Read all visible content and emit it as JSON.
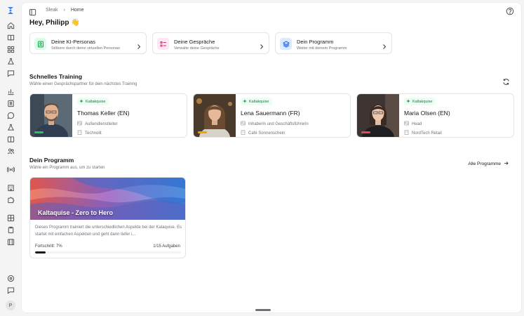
{
  "app": {
    "name": "Sleak"
  },
  "breadcrumb": {
    "root": "Sleak",
    "current": "Home"
  },
  "greeting": "Hey, Philipp 👋",
  "sidebar": {
    "avatar_initial": "P"
  },
  "quick_links": [
    {
      "title": "Deine KI-Personas",
      "subtitle": "Stöbere durch deine virtuellen Personas",
      "icon": "persona-icon",
      "color": "#16a34a",
      "bg": "#dcfce7"
    },
    {
      "title": "Deine Gespräche",
      "subtitle": "Verwalte deine Gespräche",
      "icon": "list-icon",
      "color": "#db2777",
      "bg": "#fce7f3"
    },
    {
      "title": "Dein Programm",
      "subtitle": "Weiter mit deinem Programm",
      "icon": "layers-icon",
      "color": "#2563eb",
      "bg": "#dbeafe"
    }
  ],
  "training": {
    "title": "Schnelles Training",
    "subtitle": "Wähle einen Gesprächspartner für dein nächstes Training",
    "personas": [
      {
        "badge": "Kaltakquise",
        "name": "Thomas Keller (EN)",
        "role": "Außendienstleiter",
        "company": "Technolit",
        "status_color": "#22c55e"
      },
      {
        "badge": "Kaltakquise",
        "name": "Lena Sauermann (FR)",
        "role": "Inhaberin und Geschäftsführerin",
        "company": "Café Sonnenschein",
        "status_color": "#f59e0b"
      },
      {
        "badge": "Kaltakquise",
        "name": "Maria Olsen (EN)",
        "role": "Head",
        "company": "NordTech Retail",
        "status_color": "#ef4444"
      }
    ]
  },
  "program_section": {
    "title": "Dein Programm",
    "subtitle": "Wähle ein Programm aus, um zu starten",
    "all_link": "Alle Programme"
  },
  "program": {
    "title": "Kaltaquise - Zero to Hero",
    "description": "Dieses Programm trainiert die unterschiedlichen Aspekte bei der Kalaquise. Es startet mit einfachen Aspekten und geht dann tiefer i...",
    "progress_label": "Fortschritt: 7%",
    "progress": 0.07,
    "tasks": "1/15 Aufgaben"
  }
}
